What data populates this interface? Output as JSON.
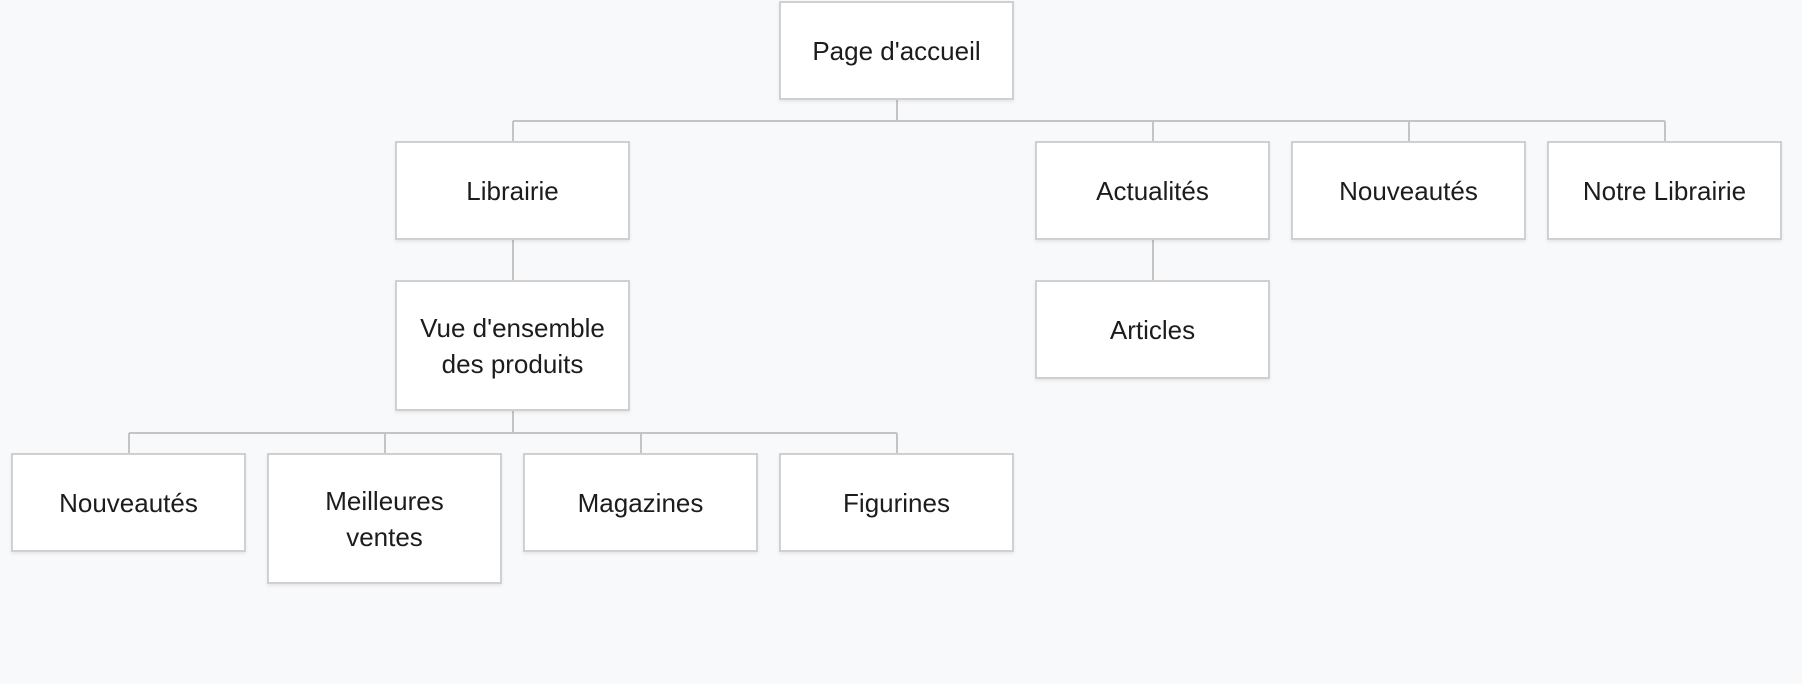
{
  "sitemap": {
    "root": "Page d'accueil",
    "librairie": "Librairie",
    "vue_ensemble_line1": "Vue d'ensemble",
    "vue_ensemble_line2": "des produits",
    "nouveautes_sub": "Nouveautés",
    "meilleures_line1": "Meilleures",
    "meilleures_line2": "ventes",
    "magazines": "Magazines",
    "figurines": "Figurines",
    "actualites": "Actualités",
    "articles": "Articles",
    "nouveautes_top": "Nouveautés",
    "notre_librairie": "Notre Librairie"
  }
}
